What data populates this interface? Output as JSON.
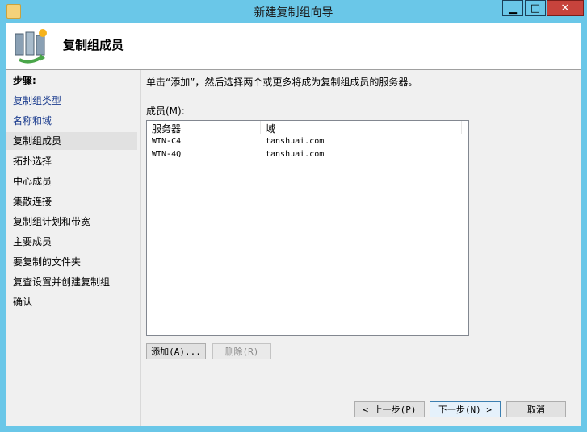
{
  "window": {
    "title": "新建复制组向导"
  },
  "header": {
    "title": "复制组成员"
  },
  "steps": {
    "label": "步骤:",
    "items": [
      {
        "label": "复制组类型",
        "state": "done"
      },
      {
        "label": "名称和域",
        "state": "done"
      },
      {
        "label": "复制组成员",
        "state": "current"
      },
      {
        "label": "拓扑选择",
        "state": "todo"
      },
      {
        "label": "中心成员",
        "state": "todo"
      },
      {
        "label": "集散连接",
        "state": "todo"
      },
      {
        "label": "复制组计划和带宽",
        "state": "todo"
      },
      {
        "label": "主要成员",
        "state": "todo"
      },
      {
        "label": "要复制的文件夹",
        "state": "todo"
      },
      {
        "label": "复查设置并创建复制组",
        "state": "todo"
      },
      {
        "label": "确认",
        "state": "todo"
      }
    ]
  },
  "content": {
    "instruction": "单击“添加”，然后选择两个或更多将成为复制组成员的服务器。",
    "members_label": "成员(M):",
    "columns": [
      "服务器",
      "域"
    ],
    "rows": [
      [
        "WIN-C4",
        "tanshuai.com"
      ],
      [
        "WIN-4Q",
        "tanshuai.com"
      ]
    ],
    "add_button": "添加(A)...",
    "remove_button": "删除(R)"
  },
  "footer": {
    "back_button": "< 上一步(P)",
    "next_button": "下一步(N) >",
    "cancel_button": "取消"
  },
  "colors": {
    "titlebar": "#6ac7e8",
    "close": "#c7433c",
    "step_done": "#1b3c8e"
  }
}
